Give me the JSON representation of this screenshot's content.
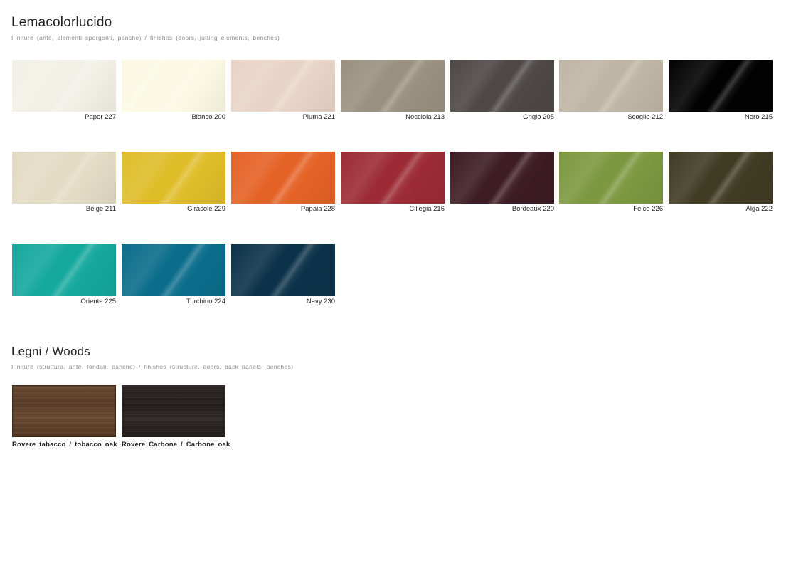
{
  "lucido": {
    "title": "Lemacolorlucido",
    "subtitle": "Finiture (ante, elementi sporgenti, panche) / finishes (doors, jutting elements, benches)",
    "swatches": [
      {
        "label": "Paper 227",
        "color": "#f2f0e6"
      },
      {
        "label": "Bianco 200",
        "color": "#fbf9e3"
      },
      {
        "label": "Piuma 221",
        "color": "#e8d4c6"
      },
      {
        "label": "Nocciola 213",
        "color": "#99907f"
      },
      {
        "label": "Grigio 205",
        "color": "#4d4846"
      },
      {
        "label": "Scoglio 212",
        "color": "#bfb5a5"
      },
      {
        "label": "Nero 215",
        "color": "#020202"
      },
      {
        "label": "Beige 211",
        "color": "#e3dbc4"
      },
      {
        "label": "Girasole 229",
        "color": "#dfbd29"
      },
      {
        "label": "Papaia 228",
        "color": "#e56226"
      },
      {
        "label": "Ciliegia 216",
        "color": "#9c2b35"
      },
      {
        "label": "Bordeaux 220",
        "color": "#3d1c23"
      },
      {
        "label": "Felce 226",
        "color": "#7c9840"
      },
      {
        "label": "Alga 222",
        "color": "#403b23"
      },
      {
        "label": "Oriente 225",
        "color": "#15a89d"
      },
      {
        "label": "Turchino 224",
        "color": "#0b6d8b"
      },
      {
        "label": "Navy 230",
        "color": "#0c3249"
      }
    ]
  },
  "woods": {
    "title": "Legni / Woods",
    "subtitle": "Finiture (struttura, ante, fondali, panche) / finishes (structure, doors, back panels, benches)",
    "swatches": [
      {
        "label": "Rovere tabacco / tobacco oak",
        "variant": "tabacco"
      },
      {
        "label": "Rovere Carbone / Carbone oak",
        "variant": "carbone"
      }
    ]
  }
}
